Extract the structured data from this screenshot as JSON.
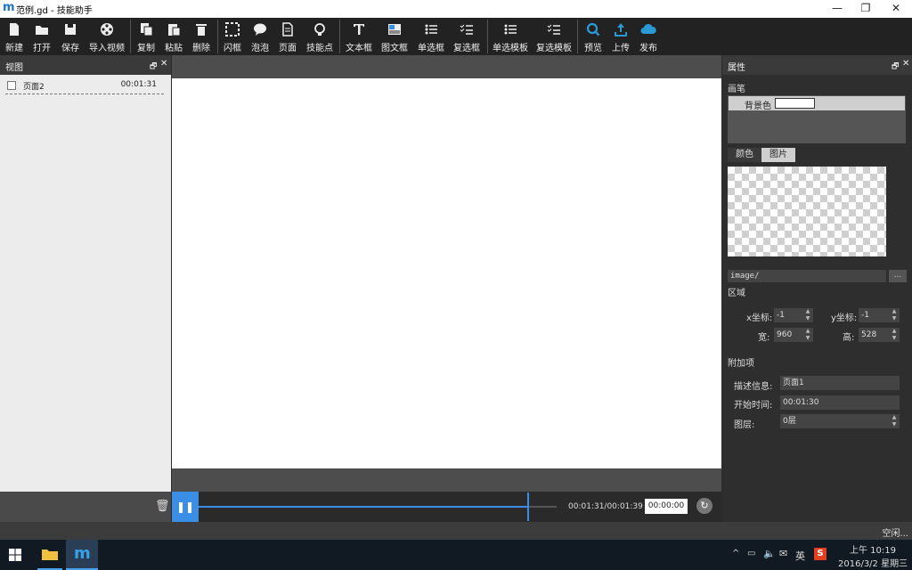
{
  "titlebar": {
    "title": "范例.gd - 技能助手",
    "logo": "m",
    "minimize": "—",
    "maximize": "❐",
    "close": "✕"
  },
  "toolbar": {
    "items": [
      {
        "label": "新建",
        "icon": "new-file-icon"
      },
      {
        "label": "打开",
        "icon": "open-folder-icon"
      },
      {
        "label": "保存",
        "icon": "save-icon"
      },
      {
        "label": "导入视频",
        "icon": "film-reel-icon"
      },
      {
        "label": "复制",
        "icon": "copy-icon"
      },
      {
        "label": "粘贴",
        "icon": "paste-icon"
      },
      {
        "label": "删除",
        "icon": "trash-icon"
      },
      {
        "label": "闪框",
        "icon": "dashed-frame-icon"
      },
      {
        "label": "泡泡",
        "icon": "speech-bubble-icon"
      },
      {
        "label": "页面",
        "icon": "page-icon"
      },
      {
        "label": "技能点",
        "icon": "lightbulb-icon"
      },
      {
        "label": "文本框",
        "icon": "text-icon"
      },
      {
        "label": "图文框",
        "icon": "image-text-icon"
      },
      {
        "label": "单选框",
        "icon": "radio-list-icon"
      },
      {
        "label": "复选框",
        "icon": "checkbox-list-icon"
      },
      {
        "label": "单选模板",
        "icon": "radio-template-icon"
      },
      {
        "label": "复选模板",
        "icon": "checkbox-template-icon"
      },
      {
        "label": "预览",
        "icon": "search-icon"
      },
      {
        "label": "上传",
        "icon": "upload-icon"
      },
      {
        "label": "发布",
        "icon": "cloud-icon"
      }
    ]
  },
  "left_panel": {
    "title": "视图",
    "float_glyph": "🗗",
    "close_glyph": "✕",
    "items": [
      {
        "name": "页面2",
        "time": "00:01:31"
      }
    ],
    "delete_glyph": "🗑"
  },
  "timeline": {
    "play_glyph": "❚❚",
    "time_display": "00:01:31/00:01:39",
    "time_input": "00:00:00",
    "progress": 0.92
  },
  "right_panel": {
    "title": "属性",
    "float_glyph": "🗗",
    "close_glyph": "✕",
    "brush_title": "画笔",
    "bg_color_label": "背景色",
    "tabs": [
      "颜色",
      "图片"
    ],
    "image_path": "image/",
    "browse_label": "...",
    "region_title": "区域",
    "x_label": "x坐标:",
    "x_value": "-1",
    "y_label": "y坐标:",
    "y_value": "-1",
    "w_label": "宽:",
    "w_value": "960",
    "h_label": "高:",
    "h_value": "528",
    "extra_title": "附加项",
    "desc_label": "描述信息:",
    "desc_value": "页面1",
    "start_label": "开始时间:",
    "start_value": "00:01:30",
    "layer_label": "图层:",
    "layer_value": "0层"
  },
  "statusbar": {
    "text": "空闲..."
  },
  "taskbar": {
    "tray_time": "上午 10:19",
    "tray_date": "2016/3/2 星期三",
    "ime": "英",
    "tray_s": "S"
  },
  "colors": {
    "accent": "#3a8ee6",
    "toolbar_bg": "#222222",
    "panel_bg": "#2e2e2e"
  }
}
